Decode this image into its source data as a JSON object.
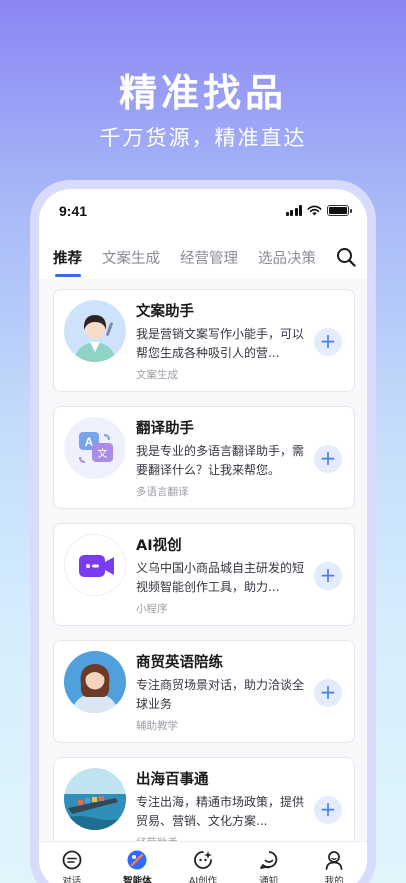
{
  "hero": {
    "title": "精准找品",
    "subtitle": "千万货源，精准直达"
  },
  "status_bar": {
    "time": "9:41"
  },
  "tabs": [
    {
      "label": "推荐"
    },
    {
      "label": "文案生成"
    },
    {
      "label": "经营管理"
    },
    {
      "label": "选品决策"
    }
  ],
  "cards": [
    {
      "name": "文案助手",
      "desc": "我是营销文案写作小能手，可以帮您生成各种吸引人的营...",
      "tag": "文案生成",
      "add": "+"
    },
    {
      "name": "翻译助手",
      "desc": "我是专业的多语言翻译助手，需要翻译什么？让我来帮您。",
      "tag": "多语言翻译",
      "add": "+"
    },
    {
      "name": "AI视创",
      "desc": "义乌中国小商品城自主研发的短视频智能创作工具，助力...",
      "tag": "小程序",
      "add": "+"
    },
    {
      "name": "商贸英语陪练",
      "desc": "专注商贸场景对话，助力洽谈全球业务",
      "tag": "辅助教学",
      "add": "+"
    },
    {
      "name": "出海百事通",
      "desc": "专注出海，精通市场政策，提供贸易、营销、文化方案...",
      "tag": "经营助手",
      "add": "+"
    }
  ],
  "bottom_nav": [
    {
      "label": "对话",
      "icon": "chat-icon"
    },
    {
      "label": "智能体",
      "icon": "agent-icon",
      "active": true
    },
    {
      "label": "AI创作",
      "icon": "ai-create-icon"
    },
    {
      "label": "通知",
      "icon": "notification-icon"
    },
    {
      "label": "我的",
      "icon": "profile-icon"
    }
  ],
  "colors": {
    "accent": "#2f6bff",
    "add_button_bg": "#e4ecfb",
    "hero_gradient_top": "#8a86f4"
  }
}
